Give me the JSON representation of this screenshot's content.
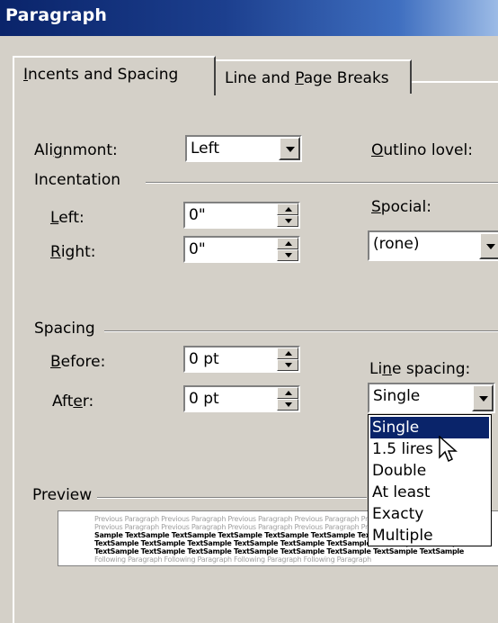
{
  "window": {
    "title": "Paragraph"
  },
  "tabs": [
    {
      "label_pre": "",
      "label_u": "I",
      "label_post": "ncents and Spacing",
      "active": true
    },
    {
      "label_pre": "Line and ",
      "label_u": "P",
      "label_post": "age Breaks",
      "active": false
    }
  ],
  "alignment": {
    "label_pre": "Ali",
    "label_u": "g",
    "label_post": "nmont:",
    "value": "Left"
  },
  "outline": {
    "label_u": "O",
    "label_post": "utlino lovel:"
  },
  "indentation": {
    "group_label": "Incentation",
    "left": {
      "label_u": "L",
      "label_post": "eft:",
      "value": "0\""
    },
    "right": {
      "label_u": "R",
      "label_post": "ight:",
      "value": "0\""
    },
    "special": {
      "label_u": "S",
      "label_post": "pocial:",
      "value": "(rone)"
    }
  },
  "spacing": {
    "group_label": "Spacing",
    "before": {
      "label_u": "B",
      "label_post": "efore:",
      "value": "0 pt"
    },
    "after": {
      "label_pre": "Aft",
      "label_u": "e",
      "label_post": "r:",
      "value": "0 pt"
    },
    "line_spacing": {
      "label_pre": "Li",
      "label_u": "n",
      "label_post": "e spacing:",
      "value": "Single"
    }
  },
  "line_spacing_options": [
    "Single",
    "1.5 lires",
    "Double",
    "At least",
    "Exacty",
    "Multiple"
  ],
  "selected_option_index": 0,
  "preview": {
    "label": "Preview",
    "lines": [
      {
        "style": "grey",
        "text": "Previous Paragraph Previous Paragraph Previous Paragraph Previous Paragraph Previous Paragraph"
      },
      {
        "style": "grey",
        "text": "Previous Paragraph Previous Paragraph Previous Paragraph Previous Paragraph Previous Paragraph"
      },
      {
        "style": "bold",
        "text": "Sample TextSample TextSample TextSample TextSample TextSample TextSample TextSample Text"
      },
      {
        "style": "bold",
        "text": "TextSample TextSample TextSample TextSample TextSample TextSample TextSample TextSample"
      },
      {
        "style": "bold",
        "text": "TextSample TextSample TextSample TextSample TextSample TextSample TextSample TextSample"
      },
      {
        "style": "grey",
        "text": "Following Paragraph Following Paragraph Following Paragraph Following Paragraph"
      }
    ]
  },
  "colors": {
    "title_gradient_start": "#0a246a",
    "title_gradient_end": "#9cbbe6",
    "dialog_bg": "#d4d0c8",
    "selection": "#0a246a"
  }
}
